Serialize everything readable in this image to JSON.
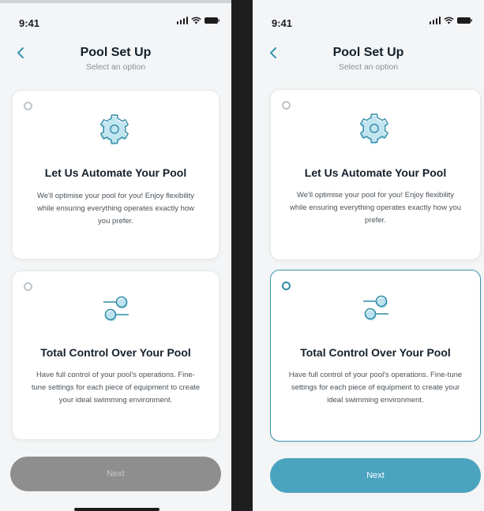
{
  "status_bar": {
    "time": "9:41"
  },
  "header": {
    "title": "Pool Set Up",
    "subtitle": "Select an option"
  },
  "options": [
    {
      "title": "Let Us Automate Your Pool",
      "description": "We'll optimise your pool for you! Enjoy flexibility while ensuring everything operates exactly how you prefer.",
      "icon": "gear-icon"
    },
    {
      "title": "Total Control Over Your Pool",
      "description": "Have full control of your pool's operations. Fine-tune settings for each piece of equipment to create your ideal swimming environment.",
      "icon": "sliders-icon"
    }
  ],
  "next_button": {
    "label": "Next"
  },
  "screens": [
    {
      "state": "no selection",
      "selected_option": null,
      "next_enabled": false
    },
    {
      "state": "option selected",
      "selected_option": "Total Control Over Your Pool",
      "next_enabled": true
    }
  ],
  "colors": {
    "accent": "#4aa3bf",
    "accent_dark": "#2f8ba6",
    "icon_fill": "#8fd0e4",
    "disabled_button": "#8e8e8e",
    "background": "#f3f5f6",
    "title_text": "#15202b"
  }
}
